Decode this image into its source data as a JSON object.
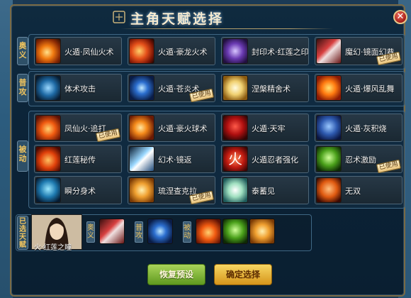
{
  "window": {
    "title": "主角天赋选择",
    "close_glyph": "✕"
  },
  "sections": {
    "aoyi": {
      "label": "奥义",
      "cards": [
        {
          "name": "火遁·凤仙火术",
          "icon": "fireball-icon",
          "used": false
        },
        {
          "name": "火遁·豪龙火术",
          "icon": "fire-dragon-icon",
          "used": false
        },
        {
          "name": "封印术·红莲之印",
          "icon": "seal-icon",
          "used": false
        },
        {
          "name": "魔幻·镜面幻巷",
          "icon": "crystal-icon",
          "used": true
        }
      ]
    },
    "gongji": {
      "label": "普攻",
      "cards": [
        {
          "name": "体术攻击",
          "icon": "fist-icon",
          "used": false
        },
        {
          "name": "火遁·苍炎术",
          "icon": "blue-flame-icon",
          "used": true
        },
        {
          "name": "涅槃精舍术",
          "icon": "white-flame-icon",
          "used": false
        },
        {
          "name": "火遁·爆风乱舞",
          "icon": "fire-storm-icon",
          "used": false
        }
      ]
    },
    "beidong": {
      "label": "被动",
      "cards": [
        {
          "name": "凤仙火·追打",
          "icon": "triple-fire-icon",
          "used": true
        },
        {
          "name": "火遁·豪火球术",
          "icon": "fireball-big-icon",
          "used": false
        },
        {
          "name": "火遁·天牢",
          "icon": "red-figure-icon",
          "used": false
        },
        {
          "name": "火遁·灰积烧",
          "icon": "blue-figure-icon",
          "used": false
        },
        {
          "name": "红莲秘传",
          "icon": "lotus-fire-icon",
          "used": false
        },
        {
          "name": "幻术·镜返",
          "icon": "mirror-icon",
          "used": false
        },
        {
          "name": "火遁忍者强化",
          "icon": "fire-kanji-icon",
          "used": false
        },
        {
          "name": "忍术激励",
          "icon": "green-figure-icon",
          "used": true
        },
        {
          "name": "瞬分身术",
          "icon": "clone-icon",
          "used": false
        },
        {
          "name": "琉涅查克拉",
          "icon": "chakra-fist-icon",
          "used": true
        },
        {
          "name": "泰蓄见",
          "icon": "orb-icon",
          "used": false
        },
        {
          "name": "无双",
          "icon": "orange-figure-icon",
          "used": false
        }
      ]
    }
  },
  "used_badge": "已使用",
  "selected": {
    "label": "已选天赋",
    "character_name": "火·红莲之瞳",
    "aoyi_label": "奥义",
    "gongji_label": "普攻",
    "beidong_label": "被动"
  },
  "buttons": {
    "reset": "恢复预设",
    "confirm": "确定选择"
  },
  "colors": {
    "accent_gold": "#f0c45e",
    "panel_bg": "#0b2236",
    "badge": "#e8c27a"
  }
}
